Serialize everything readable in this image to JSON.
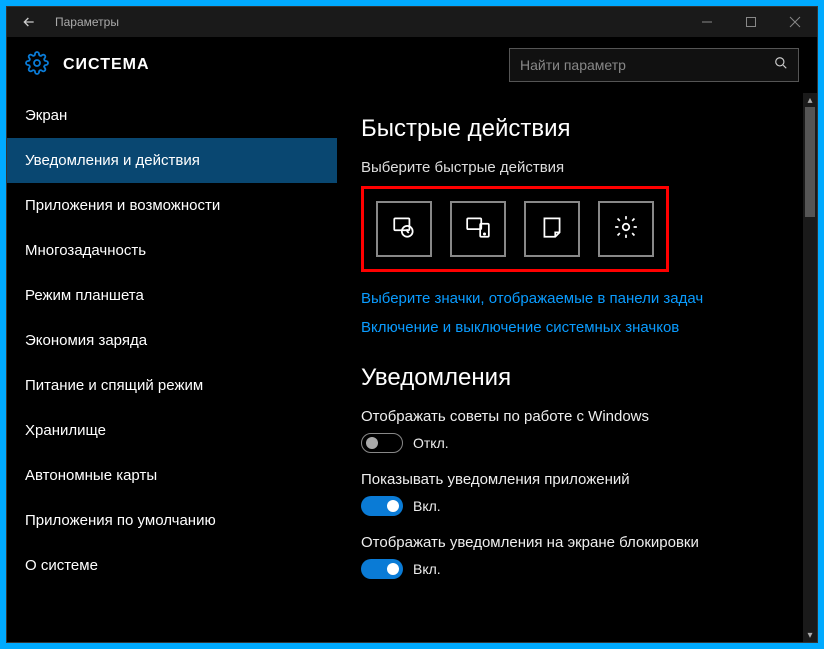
{
  "titlebar": {
    "appName": "Параметры"
  },
  "header": {
    "title": "СИСТЕМА"
  },
  "search": {
    "placeholder": "Найти параметр"
  },
  "sidebar": {
    "items": [
      {
        "label": "Экран"
      },
      {
        "label": "Уведомления и действия"
      },
      {
        "label": "Приложения и возможности"
      },
      {
        "label": "Многозадачность"
      },
      {
        "label": "Режим планшета"
      },
      {
        "label": "Экономия заряда"
      },
      {
        "label": "Питание и спящий режим"
      },
      {
        "label": "Хранилище"
      },
      {
        "label": "Автономные карты"
      },
      {
        "label": "Приложения по умолчанию"
      },
      {
        "label": "О системе"
      }
    ],
    "activeIndex": 1
  },
  "content": {
    "quickActions": {
      "heading": "Быстрые действия",
      "sub": "Выберите быстрые действия",
      "tiles": [
        {
          "icon": "tablet-mode"
        },
        {
          "icon": "connect"
        },
        {
          "icon": "note"
        },
        {
          "icon": "settings"
        }
      ]
    },
    "links": {
      "taskbarIcons": "Выберите значки, отображаемые в панели задач",
      "systemIcons": "Включение и выключение системных значков"
    },
    "notifications": {
      "heading": "Уведомления",
      "settings": [
        {
          "label": "Отображать советы по работе с Windows",
          "on": false
        },
        {
          "label": "Показывать уведомления приложений",
          "on": true
        },
        {
          "label": "Отображать уведомления на экране блокировки",
          "on": true
        }
      ]
    },
    "toggleStates": {
      "on": "Вкл.",
      "off": "Откл."
    }
  }
}
